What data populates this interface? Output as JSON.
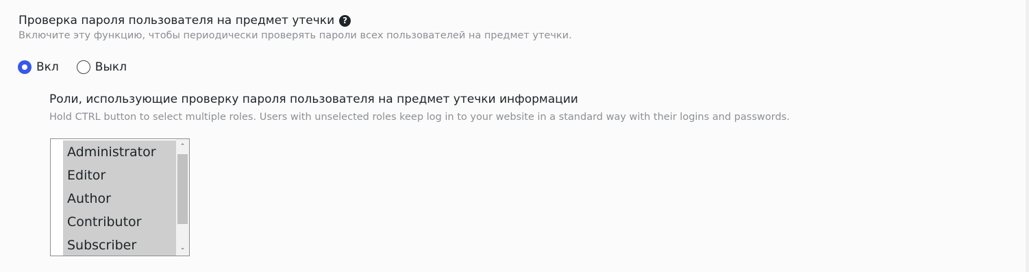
{
  "leak_check": {
    "title": "Проверка пароля пользователя на предмет утечки",
    "help_glyph": "?",
    "description": "Включите эту функцию, чтобы периодически проверять пароли всех пользователей на предмет утечки.",
    "options": [
      {
        "label": "Вкл",
        "checked": true
      },
      {
        "label": "Выкл",
        "checked": false
      }
    ]
  },
  "roles": {
    "title": "Роли, использующие проверку пароля пользователя на предмет утечки информации",
    "description": "Hold CTRL button to select multiple roles. Users with unselected roles keep log in to your website in a standard way with their logins and passwords.",
    "items": [
      {
        "label": "Administrator",
        "selected": true
      },
      {
        "label": "Editor",
        "selected": true
      },
      {
        "label": "Author",
        "selected": true
      },
      {
        "label": "Contributor",
        "selected": true
      },
      {
        "label": "Subscriber",
        "selected": true
      }
    ],
    "scroll_up_glyph": "⌃",
    "scroll_down_glyph": "⌄"
  },
  "colors": {
    "accent": "#3858e9",
    "muted_text": "#8c8f94",
    "selected_option_bg": "#cecece"
  }
}
